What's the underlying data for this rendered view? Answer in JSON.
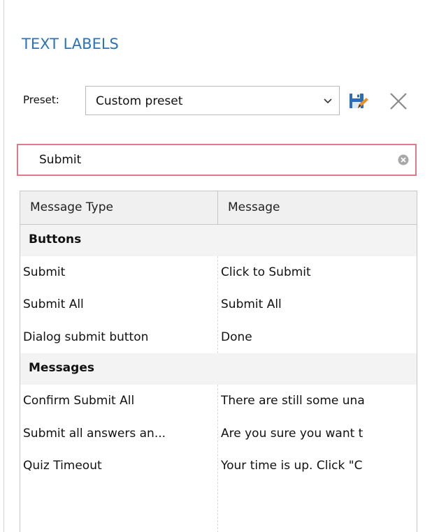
{
  "panel": {
    "title": "TEXT LABELS"
  },
  "preset": {
    "label": "Preset:",
    "selected": "Custom preset",
    "save_icon": "save-icon",
    "delete_icon": "close-icon"
  },
  "search": {
    "value": "Submit",
    "clear_icon": "clear-circle-icon"
  },
  "table": {
    "columns": [
      "Message Type",
      "Message"
    ],
    "groups": [
      {
        "name": "Buttons",
        "rows": [
          [
            "Submit",
            "Click to Submit"
          ],
          [
            "Submit All",
            "Submit All"
          ],
          [
            "Dialog submit button",
            "Done"
          ]
        ]
      },
      {
        "name": "Messages",
        "rows": [
          [
            "Confirm Submit All",
            "There are still some una"
          ],
          [
            "Submit all answers an...",
            "Are you sure you want t"
          ],
          [
            "Quiz Timeout",
            "Your time is up. Click \"C"
          ]
        ]
      }
    ]
  },
  "colors": {
    "title": "#2b73b7",
    "search_border": "#e07a86",
    "save_blue": "#2d6db5",
    "save_orange": "#e8902c"
  }
}
